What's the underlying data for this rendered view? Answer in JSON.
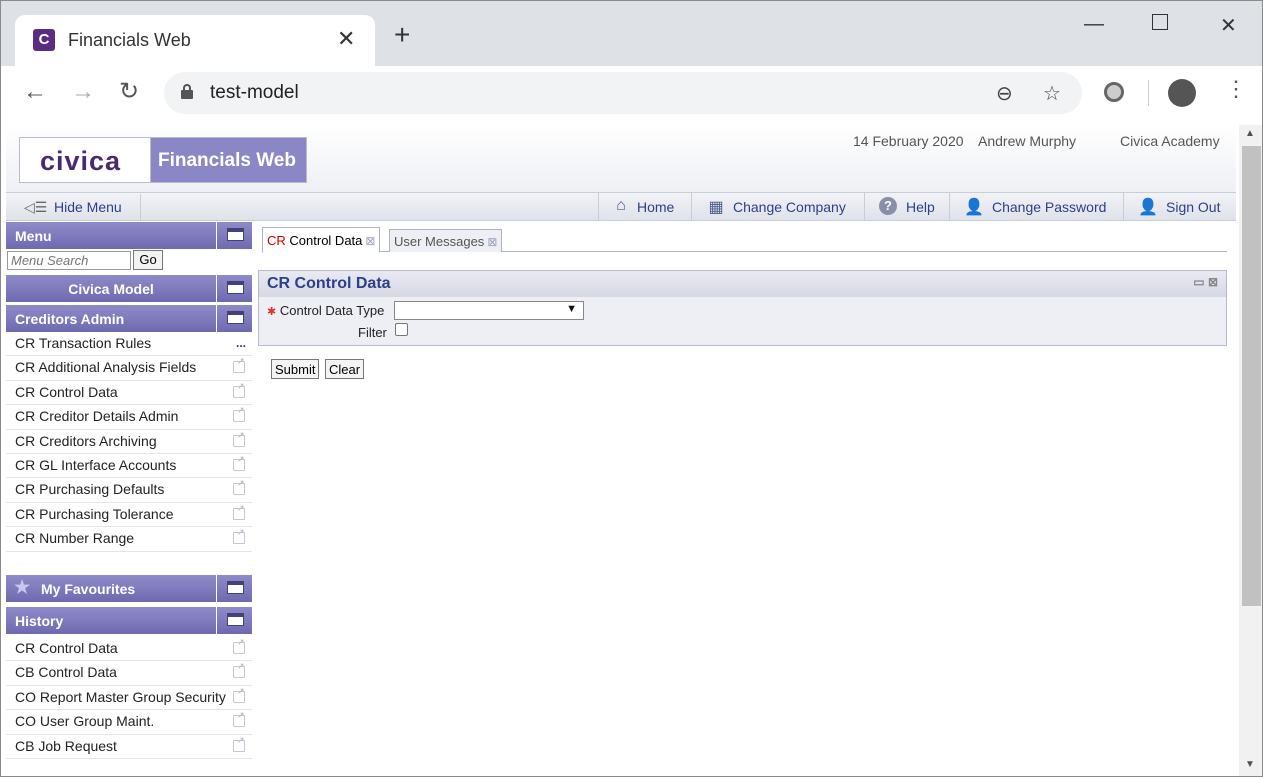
{
  "browser": {
    "tab_title": "Financials Web",
    "tab_favicon_letter": "C",
    "url": "test-model"
  },
  "header": {
    "logo": "civica",
    "product": "Financials Web",
    "date": "14 February 2020",
    "user": "Andrew Murphy",
    "org": "Civica Academy"
  },
  "menubar": {
    "hide_menu": "Hide Menu",
    "links": [
      "Home",
      "Change Company",
      "Help",
      "Change Password",
      "Sign Out"
    ]
  },
  "sidebar": {
    "menu_title": "Menu",
    "search_placeholder": "Menu Search",
    "go_label": "Go",
    "model_title": "Civica Model",
    "section_title": "Creditors Admin",
    "items": [
      "CR Transaction Rules",
      "CR Additional Analysis Fields",
      "CR Control Data",
      "CR Creditor Details Admin",
      "CR Creditors Archiving",
      "CR GL Interface Accounts",
      "CR Purchasing Defaults",
      "CR Purchasing Tolerance",
      "CR Number Range"
    ],
    "favourites_title": "My Favourites",
    "history_title": "History",
    "history": [
      "CR Control Data",
      "CB Control Data",
      "CO Report Master Group Security",
      "CO User Group Maint.",
      "CB Job Request"
    ]
  },
  "content": {
    "tabs": [
      {
        "prefix": "CR",
        "label": "Control Data"
      },
      {
        "label": "User Messages"
      }
    ],
    "form_title": "CR Control Data",
    "fields": {
      "control_data_type_label": "Control Data Type",
      "control_data_type_value": "",
      "filter_label": "Filter",
      "filter_checked": false
    },
    "submit_label": "Submit",
    "clear_label": "Clear"
  }
}
